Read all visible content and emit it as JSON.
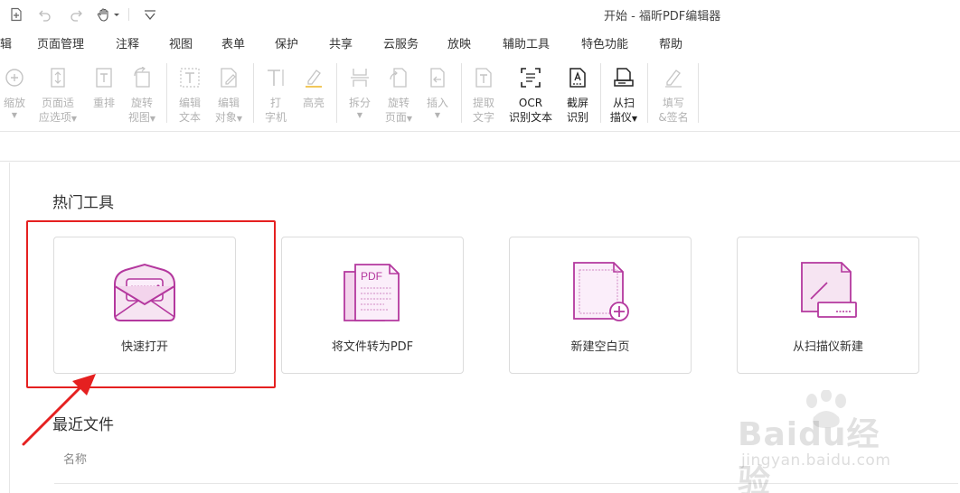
{
  "window": {
    "title": "开始 - 福昕PDF编辑器"
  },
  "quick_access": [
    {
      "icon": "new-file-icon"
    },
    {
      "icon": "undo-icon"
    },
    {
      "icon": "redo-icon"
    },
    {
      "icon": "hand-tool-icon"
    },
    {
      "icon": "customize-dropdown-icon"
    }
  ],
  "menu": [
    "辑",
    "页面管理",
    "注释",
    "视图",
    "表单",
    "保护",
    "共享",
    "云服务",
    "放映",
    "辅助工具",
    "特色功能",
    "帮助"
  ],
  "ribbon": {
    "zoom": {
      "line1": "缩放",
      "line2": ""
    },
    "page_fit": {
      "line1": "页面适",
      "line2": "应选项"
    },
    "reflow": {
      "line1": "重排",
      "line2": ""
    },
    "rotate_view": {
      "line1": "旋转",
      "line2": "视图"
    },
    "edit_text": {
      "line1": "编辑",
      "line2": "文本"
    },
    "edit_object": {
      "line1": "编辑",
      "line2": "对象"
    },
    "typewriter": {
      "line1": "打",
      "line2": "字机"
    },
    "highlight": {
      "line1": "高亮",
      "line2": ""
    },
    "split": {
      "line1": "拆分",
      "line2": ""
    },
    "rotate_page": {
      "line1": "旋转",
      "line2": "页面"
    },
    "insert": {
      "line1": "插入",
      "line2": ""
    },
    "extract_text": {
      "line1": "提取",
      "line2": "文字"
    },
    "ocr": {
      "line1": "OCR",
      "line2": "识别文本"
    },
    "screenshot_ocr": {
      "line1": "截屏",
      "line2": "识别"
    },
    "from_scanner": {
      "line1": "从扫",
      "line2": "描仪"
    },
    "fill_sign": {
      "line1": "填写",
      "line2": "&签名"
    }
  },
  "hot_tools": {
    "title": "热门工具",
    "cards": [
      {
        "label": "快速打开",
        "icon": "envelope-open-icon"
      },
      {
        "label": "将文件转为PDF",
        "icon": "convert-to-pdf-icon"
      },
      {
        "label": "新建空白页",
        "icon": "new-blank-page-icon"
      },
      {
        "label": "从扫描仪新建",
        "icon": "scanner-new-icon"
      }
    ]
  },
  "recent_files": {
    "title": "最近文件",
    "column_name": "名称"
  },
  "watermark": {
    "brand": "Baidu经验",
    "url": "jingyan.baidu.com"
  },
  "colors": {
    "accent": "#b4389e",
    "highlight_box": "#e52020",
    "disabled_text": "#b3b3b3"
  }
}
